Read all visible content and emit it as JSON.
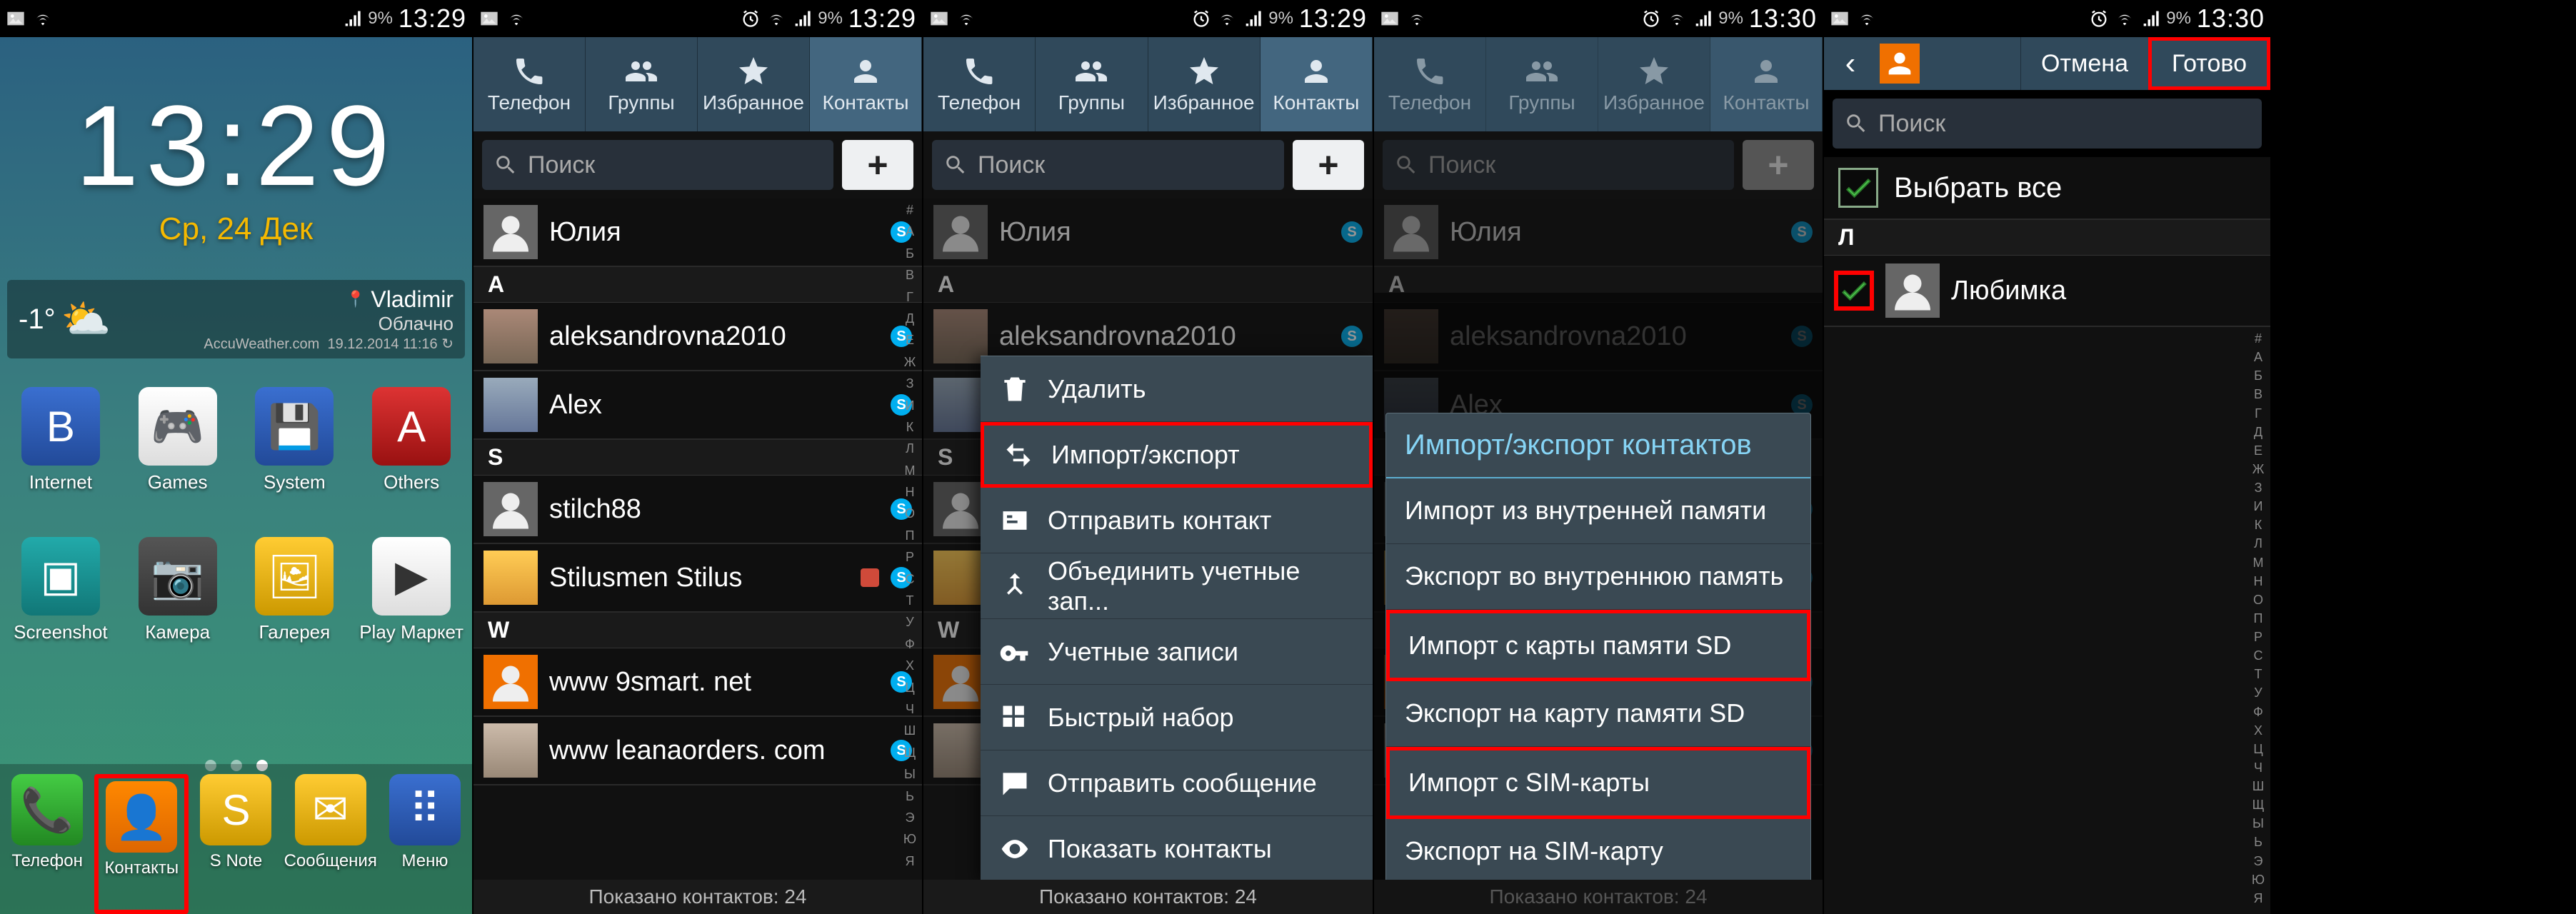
{
  "statusbar": {
    "time_1": "13:29",
    "time_2": "13:29",
    "time_3": "13:29",
    "time_4": "13:30",
    "time_5": "13:30",
    "battery": "9%"
  },
  "alpha_letters": [
    "#",
    "А",
    "Б",
    "В",
    "Г",
    "Д",
    "Е",
    "Ж",
    "З",
    "И",
    "К",
    "Л",
    "М",
    "Н",
    "О",
    "П",
    "Р",
    "С",
    "Т",
    "У",
    "Ф",
    "Х",
    "Ц",
    "Ч",
    "Ш",
    "Щ",
    "Ы",
    "Ь",
    "Э",
    "Ю",
    "Я"
  ],
  "home": {
    "clock_time": "13:29",
    "clock_date": "Ср, 24 Дек",
    "weather": {
      "temp": "-1°",
      "city": "Vladimir",
      "cond": "Облачно",
      "source": "AccuWeather.com",
      "updated": "19.12.2014 11:16"
    },
    "grid": [
      {
        "label": "Internet",
        "cls": "bg-blue",
        "glyph": "B"
      },
      {
        "label": "Games",
        "cls": "bg-white",
        "glyph": "🎮"
      },
      {
        "label": "System",
        "cls": "bg-blue",
        "glyph": "💾"
      },
      {
        "label": "Others",
        "cls": "bg-red",
        "glyph": "A"
      },
      {
        "label": "Screenshot",
        "cls": "bg-teal",
        "glyph": "▣"
      },
      {
        "label": "Камера",
        "cls": "bg-grey",
        "glyph": "📷"
      },
      {
        "label": "Галерея",
        "cls": "bg-yellow",
        "glyph": "🖼"
      },
      {
        "label": "Play Маркет",
        "cls": "bg-white",
        "glyph": "▶"
      }
    ],
    "hotseat": [
      {
        "label": "Телефон",
        "cls": "bg-green",
        "glyph": "📞"
      },
      {
        "label": "Контакты",
        "cls": "bg-orange",
        "glyph": "👤",
        "hl": true
      },
      {
        "label": "S Note",
        "cls": "bg-yellow",
        "glyph": "S"
      },
      {
        "label": "Сообщения",
        "cls": "bg-yellow",
        "glyph": "✉"
      },
      {
        "label": "Меню",
        "cls": "bg-blue",
        "glyph": "⠿"
      }
    ]
  },
  "tabs": {
    "phone": "Телефон",
    "groups": "Группы",
    "fav": "Избранное",
    "contacts": "Контакты"
  },
  "search": {
    "placeholder": "Поиск"
  },
  "contacts": {
    "footer": "Показано контактов: 24",
    "fav_name": "Юлия",
    "sec_a": "A",
    "list_a": [
      {
        "name": "aleksandrovna2010",
        "cls": "photo1",
        "skype": true
      },
      {
        "name": "Alex",
        "cls": "photo2",
        "skype": true
      }
    ],
    "sec_s": "S",
    "list_s": [
      {
        "name": "stilch88",
        "cls": "grey",
        "skype": true
      },
      {
        "name": "Stilusmen Stilus",
        "cls": "photo3",
        "skype": true,
        "gplus": true
      }
    ],
    "sec_w": "W",
    "list_w": [
      {
        "name": "www 9smart. net",
        "cls": "orange",
        "skype": true
      },
      {
        "name": "www leanaorders. com",
        "cls": "photo5",
        "skype": true
      }
    ]
  },
  "menu": {
    "delete": "Удалить",
    "import_export": "Импорт/экспорт",
    "send_contact": "Отправить контакт",
    "merge": "Объединить учетные зап...",
    "accounts": "Учетные записи",
    "speeddial": "Быстрый набор",
    "send_msg": "Отправить сообщение",
    "show_contacts": "Показать контакты"
  },
  "dialog": {
    "title": "Импорт/экспорт контактов",
    "import_internal": "Импорт из внутренней памяти",
    "export_internal": "Экспорт во внутреннюю память",
    "import_sd": "Импорт с карты памяти SD",
    "export_sd": "Экспорт на карту памяти SD",
    "import_sim": "Импорт с SIM-карты",
    "export_sim": "Экспорт на SIM-карту"
  },
  "screen5": {
    "cancel": "Отмена",
    "done": "Готово",
    "select_all": "Выбрать все",
    "sec_l": "Л",
    "contact": "Любимка"
  }
}
